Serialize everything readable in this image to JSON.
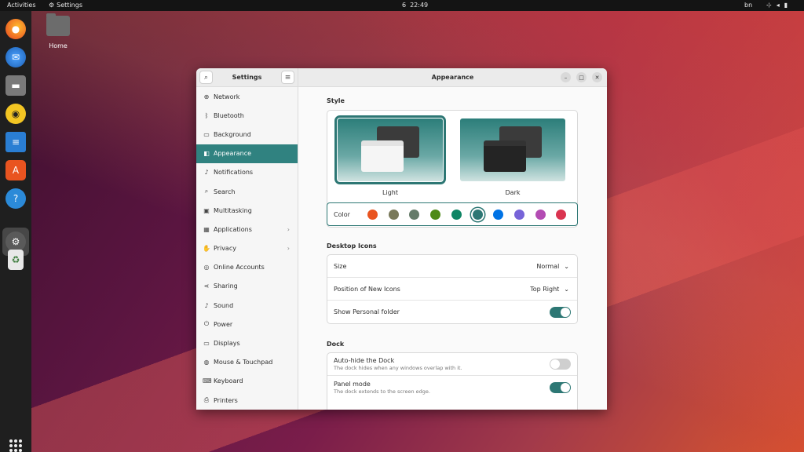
{
  "topbar": {
    "activities": "Activities",
    "app_name": "Settings",
    "workspace": "6",
    "time": "22:49",
    "lang": "bn"
  },
  "desktop": {
    "home_label": "Home"
  },
  "dock": {
    "items": [
      "firefox-icon",
      "thunderbird-icon",
      "files-icon",
      "rhythmbox-icon",
      "writer-icon",
      "software-icon",
      "help-icon",
      "settings-icon",
      "trash-icon"
    ]
  },
  "window": {
    "sidebar_title": "Settings",
    "page_title": "Appearance",
    "sidebar": [
      {
        "label": "Network",
        "icon": "network-icon"
      },
      {
        "label": "Bluetooth",
        "icon": "bluetooth-icon"
      },
      {
        "label": "Background",
        "icon": "background-icon"
      },
      {
        "label": "Appearance",
        "icon": "appearance-icon"
      },
      {
        "label": "Notifications",
        "icon": "bell-icon"
      },
      {
        "label": "Search",
        "icon": "search-icon"
      },
      {
        "label": "Multitasking",
        "icon": "multitasking-icon"
      },
      {
        "label": "Applications",
        "icon": "apps-icon"
      },
      {
        "label": "Privacy",
        "icon": "privacy-icon"
      },
      {
        "label": "Online Accounts",
        "icon": "accounts-icon"
      },
      {
        "label": "Sharing",
        "icon": "share-icon"
      },
      {
        "label": "Sound",
        "icon": "music-icon"
      },
      {
        "label": "Power",
        "icon": "power-icon"
      },
      {
        "label": "Displays",
        "icon": "display-icon"
      },
      {
        "label": "Mouse & Touchpad",
        "icon": "mouse-icon"
      },
      {
        "label": "Keyboard",
        "icon": "keyboard-icon"
      },
      {
        "label": "Printers",
        "icon": "printer-icon"
      }
    ],
    "style": {
      "title": "Style",
      "light": "Light",
      "dark": "Dark",
      "color_label": "Color",
      "colors": [
        "#e95420",
        "#787859",
        "#657b69",
        "#4e8a17",
        "#0f8565",
        "#2d7774",
        "#0073e5",
        "#7764d8",
        "#b34cb3",
        "#da3450"
      ],
      "selected_color": 5
    },
    "desktop_icons": {
      "title": "Desktop Icons",
      "size_label": "Size",
      "size_value": "Normal",
      "position_label": "Position of New Icons",
      "position_value": "Top Right",
      "personal_label": "Show Personal folder",
      "personal_on": true
    },
    "dock": {
      "title": "Dock",
      "autohide_label": "Auto-hide the Dock",
      "autohide_sub": "The dock hides when any windows overlap with it.",
      "panel_label": "Panel mode",
      "panel_sub": "The dock extends to the screen edge."
    }
  }
}
